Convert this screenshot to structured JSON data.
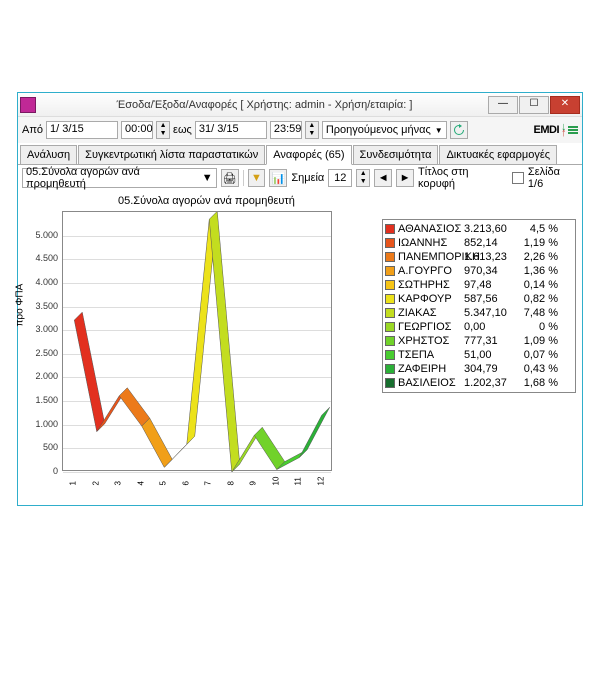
{
  "window": {
    "title": "Έσοδα/Έξοδα/Αναφορές   [ Χρήστης: admin - Χρήση/εταιρία:                     ]"
  },
  "toolbar": {
    "from_label": "Από",
    "from_date": "1/ 3/15",
    "from_time": "00:00",
    "to_label": "εως",
    "to_date": "31/ 3/15",
    "to_time": "23:59",
    "period_select": "Προηγούμενος μήνας"
  },
  "logo_text": "EMDI",
  "tabs": {
    "t1": "Ανάλυση",
    "t2": "Συγκεντρωτική λίστα παραστατικών",
    "t3": "Αναφορές (65)",
    "t4": "Συνδεσιμότητα",
    "t5": "Δικτυακές εφαρμογές"
  },
  "toolbar2": {
    "report": "05.Σύνολα αγορών ανά προμηθευτή",
    "points_label": "Σημεία",
    "points_value": "12",
    "title_at_top": "Τίτλος στη κορυφή",
    "page": "Σελίδα 1/6"
  },
  "chart_data": {
    "type": "line",
    "title": "05.Σύνολα αγορών ανά προμηθευτή",
    "ylabel": "προ ΦΠΑ",
    "xlabel": "",
    "ylim": [
      0,
      5500
    ],
    "y_ticks": [
      0,
      500,
      1000,
      1500,
      2000,
      2500,
      3000,
      3500,
      4000,
      4500,
      5000
    ],
    "x": [
      1,
      2,
      3,
      4,
      5,
      6,
      7,
      8,
      9,
      10,
      11,
      12
    ],
    "series": [
      {
        "name": "ΑΘΑΝΑΣΙΟΣ",
        "value": 3213.6,
        "pct": "4,5 %",
        "color": "#e2301f"
      },
      {
        "name": "ΙΩΑΝΝΗΣ",
        "value": 852.14,
        "pct": "1,19 %",
        "color": "#e7551c"
      },
      {
        "name": "ΠΑΝΕΜΠΟΡΙΚΗ",
        "value": 1613.23,
        "pct": "2,26 %",
        "color": "#ec7a1a"
      },
      {
        "name": "Α.ΓΟΥΡΓΟ",
        "value": 970.34,
        "pct": "1,36 %",
        "color": "#f19f18"
      },
      {
        "name": "ΣΩΤΗΡΗΣ",
        "value": 97.48,
        "pct": "0,14 %",
        "color": "#f6c416"
      },
      {
        "name": "ΚΑΡΦΟΥΡ",
        "value": 587.56,
        "pct": "0,82 %",
        "color": "#ece21a"
      },
      {
        "name": "ΖΙΑΚΑΣ",
        "value": 5347.1,
        "pct": "7,48 %",
        "color": "#c3dd1f"
      },
      {
        "name": "ΓΕΩΡΓΙΟΣ",
        "value": 0.0,
        "pct": "0 %",
        "color": "#9ad825"
      },
      {
        "name": "ΧΡΗΣΤΟΣ",
        "value": 777.31,
        "pct": "1,09 %",
        "color": "#71d22a"
      },
      {
        "name": "ΤΣΕΠΑ",
        "value": 51.0,
        "pct": "0,07 %",
        "color": "#48cd30"
      },
      {
        "name": "ΖΑΦΕΙΡΗ",
        "value": 304.79,
        "pct": "0,43 %",
        "color": "#2bb038"
      },
      {
        "name": "ΒΑΣΙΛΕΙΟΣ",
        "value": 1202.37,
        "pct": "1,68 %",
        "color": "#176e2e"
      }
    ]
  }
}
